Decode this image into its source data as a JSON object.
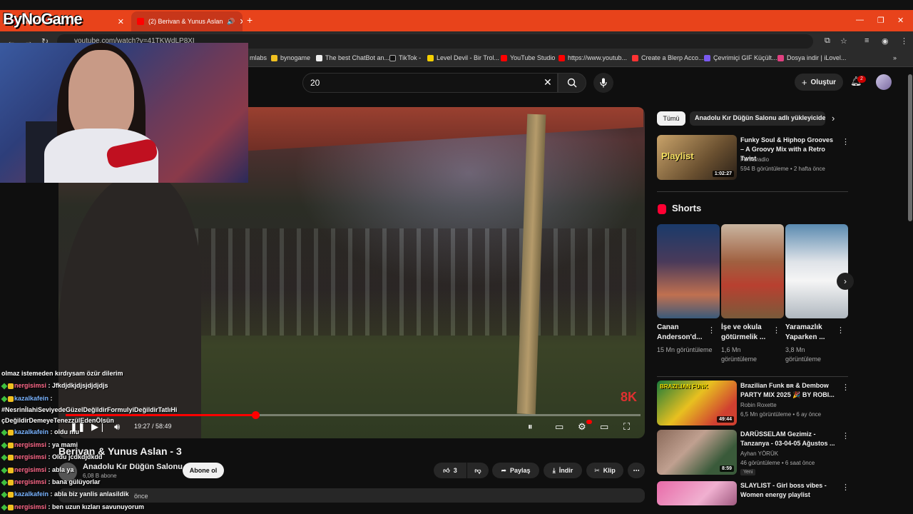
{
  "browser": {
    "tabs": [
      {
        "label": "Playlist 🔴 - Y"
      },
      {
        "label": "(2) Berivan & Yunus Aslan"
      }
    ],
    "url": "youtube.com/watch?v=41TKWdLP8XI",
    "bookmarks": [
      {
        "label": "mlabs"
      },
      {
        "label": "bynogame"
      },
      {
        "label": "The best ChatBot an..."
      },
      {
        "label": "TikTok -"
      },
      {
        "label": "Level Devil - Bir Trol..."
      },
      {
        "label": "YouTube Studio"
      },
      {
        "label": "https://www.youtub..."
      },
      {
        "label": "Create a Blerp Acco..."
      },
      {
        "label": "Çevrimiçi GIF Küçült..."
      },
      {
        "label": "Dosya indir | iLovel..."
      }
    ]
  },
  "youtube": {
    "search_value": "20",
    "create_label": "Oluştur",
    "notification_count": "2"
  },
  "player": {
    "time_current": "19:27",
    "time_total": "58:49",
    "time_display": "19:27 / 58:49",
    "progress_fraction": 0.3306,
    "watermark": "8K"
  },
  "video": {
    "title": "Berivan & Yunus Aslan - 3",
    "channel": "Anadolu Kır Düğün Salonu",
    "subscribers": "6,08 B abone",
    "subscribe_label": "Abone ol",
    "likes": "3",
    "share_label": "Paylaş",
    "download_label": "İndir",
    "clip_label": "Klip",
    "uploaded_ago": "önce"
  },
  "sidebar": {
    "chips": [
      {
        "label": "Tümü"
      },
      {
        "label": "Anadolu Kır Düğün Salonu adlı yükleyiciden"
      }
    ],
    "videos": [
      {
        "title": "Funky Soul & Hiphop Grooves – A Groovy Mix with a Retro Twist",
        "channel": "Funkaradio",
        "meta": "594 B görüntüleme • 2 hafta önce",
        "duration": "1:02:27",
        "thumb_text": "Playlist"
      },
      {
        "title": "Brazilian Funk ʙʀ & Dembow PARTY MIX 2025 🎉 BY ROBI...",
        "channel": "Robin Roxette",
        "meta": "6,5 Mn görüntüleme • 6 ay önce",
        "duration": "49:44",
        "thumb_text": "BRAZILIAN FUNK"
      },
      {
        "title": "DARÜSSELAM Gezimiz - Tanzanya - 03-04-05 Ağustos ...",
        "channel": "Ayhan YÖRÜK",
        "meta": "46 görüntüleme • 6 saat önce",
        "duration": "8:59",
        "badge": "Yeni"
      },
      {
        "title": "SLAYLIST - Girl boss vibes - Women energy playlist",
        "channel": "",
        "meta": ""
      }
    ],
    "shorts_heading": "Shorts",
    "shorts": [
      {
        "title": "Canan Anderson'd...",
        "views": "15 Mn görüntüleme"
      },
      {
        "title": "İşe ve okula götürmelik ...",
        "views": "1,6 Mn görüntüleme"
      },
      {
        "title": "Yaramazlık Yaparken ...",
        "views": "3,8 Mn görüntüleme"
      }
    ]
  },
  "overlay": {
    "logo": "ByNoGame",
    "chat": [
      {
        "user": "",
        "text": "olmaz istemeden kırdıysam özür dilerim",
        "badges": false
      },
      {
        "user": "nergisimsi",
        "text": " : Jfkdjdkjdjsjdjdjdjs",
        "badges": true
      },
      {
        "user": "kazalkafein",
        "text": " :",
        "badges": true,
        "green_only": true
      },
      {
        "user": "",
        "text": "#NesrinİlahiSeviyedeGüzelDeğildirFormulyiDeğildirTatlıHi",
        "badges": false
      },
      {
        "user": "",
        "text": "çDeğildirDemeyeTenezzülEdenÖlsün",
        "badges": false
      },
      {
        "user": "kazalkafein",
        "text": " : oldu mu",
        "badges": true,
        "green_only": true
      },
      {
        "user": "nergisimsi",
        "text": " : ya mami",
        "badges": true
      },
      {
        "user": "nergisimsi",
        "text": " : Oldu jcdkdjdkdd",
        "badges": true
      },
      {
        "user": "nergisimsi",
        "text": " : abla ya",
        "badges": true
      },
      {
        "user": "nergisimsi",
        "text": " : bana gülüyorlar",
        "badges": true
      },
      {
        "user": "kazalkafein",
        "text": " : abla biz yanlis anlasildik",
        "badges": true,
        "green_only": true
      },
      {
        "user": "nergisimsi",
        "text": " : ben uzun kızları savunuyorum",
        "badges": true
      }
    ]
  }
}
